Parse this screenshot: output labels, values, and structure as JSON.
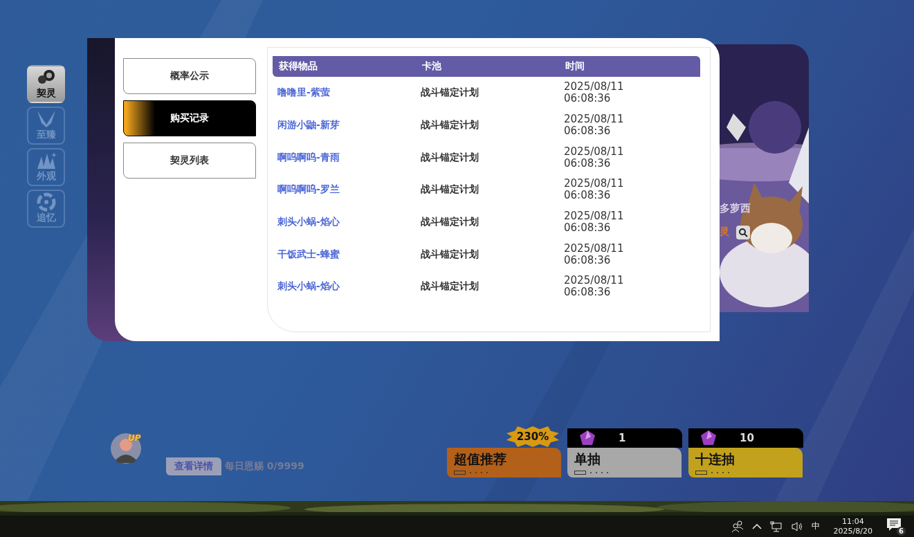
{
  "side_nav": [
    {
      "label": "契灵",
      "selected": true
    },
    {
      "label": "至臻",
      "selected": false
    },
    {
      "label": "外观",
      "selected": false
    },
    {
      "label": "追忆",
      "selected": false
    }
  ],
  "art_panel": {
    "name_fragment": "多萝西",
    "tag_fragment": "灵"
  },
  "modal": {
    "tabs": [
      {
        "label": "概率公示",
        "selected": false
      },
      {
        "label": "购买记录",
        "selected": true
      },
      {
        "label": "契灵列表",
        "selected": false
      }
    ],
    "table": {
      "columns": [
        "获得物品",
        "卡池",
        "时间"
      ],
      "rows": [
        {
          "item": "噜噜里-紫萤",
          "pool": "战斗锚定计划",
          "date": "2025/08/11",
          "time": "06:08:36"
        },
        {
          "item": "闲游小鼬-新芽",
          "pool": "战斗锚定计划",
          "date": "2025/08/11",
          "time": "06:08:36"
        },
        {
          "item": "啊呜啊呜-青雨",
          "pool": "战斗锚定计划",
          "date": "2025/08/11",
          "time": "06:08:36"
        },
        {
          "item": "啊呜啊呜-罗兰",
          "pool": "战斗锚定计划",
          "date": "2025/08/11",
          "time": "06:08:36"
        },
        {
          "item": "刺头小蜗-焰心",
          "pool": "战斗锚定计划",
          "date": "2025/08/11",
          "time": "06:08:36"
        },
        {
          "item": "干饭武士-蜂蜜",
          "pool": "战斗锚定计划",
          "date": "2025/08/11",
          "time": "06:08:36"
        },
        {
          "item": "刺头小蜗-焰心",
          "pool": "战斗锚定计划",
          "date": "2025/08/11",
          "time": "06:08:36"
        }
      ]
    }
  },
  "featured": {
    "up_badge": "UP",
    "details_button": "查看详情",
    "daily_label": "每日恩赐 0/9999"
  },
  "offers": [
    {
      "kind": "recommend",
      "title": "超值推荐",
      "badge": "230%",
      "color": "#b3601a"
    },
    {
      "kind": "draw",
      "title": "单抽",
      "cost": "1",
      "color": "#a8a8a8"
    },
    {
      "kind": "draw",
      "title": "十连抽",
      "cost": "10",
      "color": "#c2a21c"
    }
  ],
  "taskbar": {
    "ime": "中",
    "time": "11:04",
    "date": "2025/8/20",
    "notifications": "6"
  }
}
